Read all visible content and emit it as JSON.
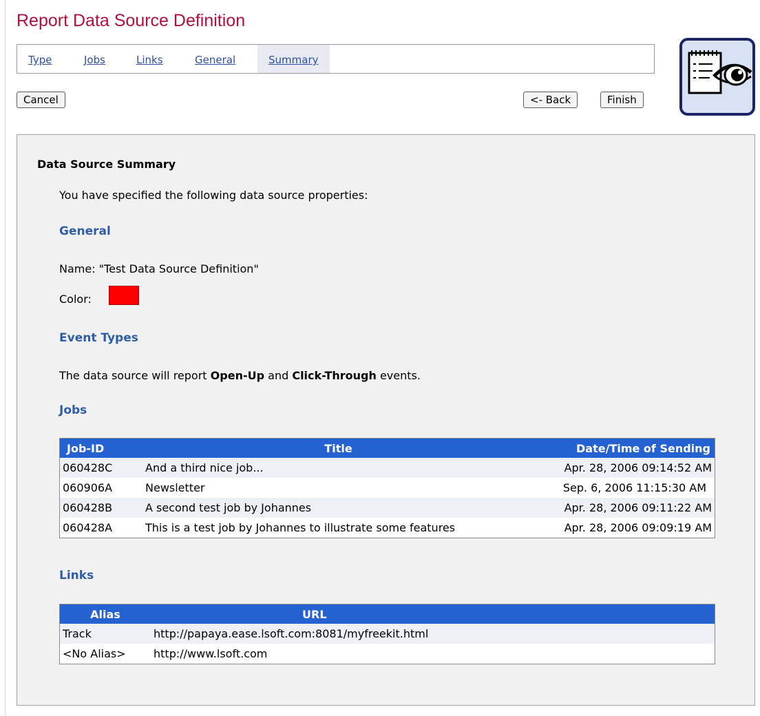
{
  "header": {
    "title": "Report Data Source Definition"
  },
  "tabs": [
    {
      "label": "Type"
    },
    {
      "label": "Jobs"
    },
    {
      "label": "Links"
    },
    {
      "label": "General"
    },
    {
      "label": "Summary",
      "active": true
    }
  ],
  "buttons": {
    "cancel": "Cancel",
    "back": "<- Back",
    "finish": "Finish"
  },
  "summary": {
    "heading": "Data Source Summary",
    "intro": "You have specified the following data source properties:",
    "general": {
      "heading": "General",
      "name_line": "Name: \"Test Data Source Definition\"",
      "color_label": "Color:",
      "color_value": "#ff0000"
    },
    "event_types": {
      "heading": "Event Types",
      "prefix": "The data source will report ",
      "event1": "Open-Up",
      "joiner": " and ",
      "event2": "Click-Through",
      "suffix": " events."
    },
    "jobs": {
      "heading": "Jobs",
      "columns": [
        "Job-ID",
        "Title",
        "Date/Time of Sending"
      ],
      "rows": [
        [
          "060428C",
          "And a third nice job...",
          "Apr. 28, 2006 09:14:52 AM"
        ],
        [
          "060906A",
          "Newsletter",
          "Sep. 6, 2006 11:15:30 AM"
        ],
        [
          "060428B",
          "A second test job by Johannes",
          "Apr. 28, 2006 09:11:22 AM"
        ],
        [
          "060428A",
          "This is a test job by Johannes to illustrate some features",
          "Apr. 28, 2006 09:09:19 AM"
        ]
      ]
    },
    "links": {
      "heading": "Links",
      "columns": [
        "Alias",
        "URL"
      ],
      "rows": [
        [
          "Track",
          "http://papaya.ease.lsoft.com:8081/myfreekit.html"
        ],
        [
          "<No Alias>",
          "http://www.lsoft.com"
        ]
      ]
    }
  },
  "colors": {
    "title": "#b0103c",
    "accent": "#2461d1",
    "section": "#2f5ea7",
    "logo_border": "#1e2468"
  },
  "logo": {
    "icon": "report-eye-icon"
  }
}
